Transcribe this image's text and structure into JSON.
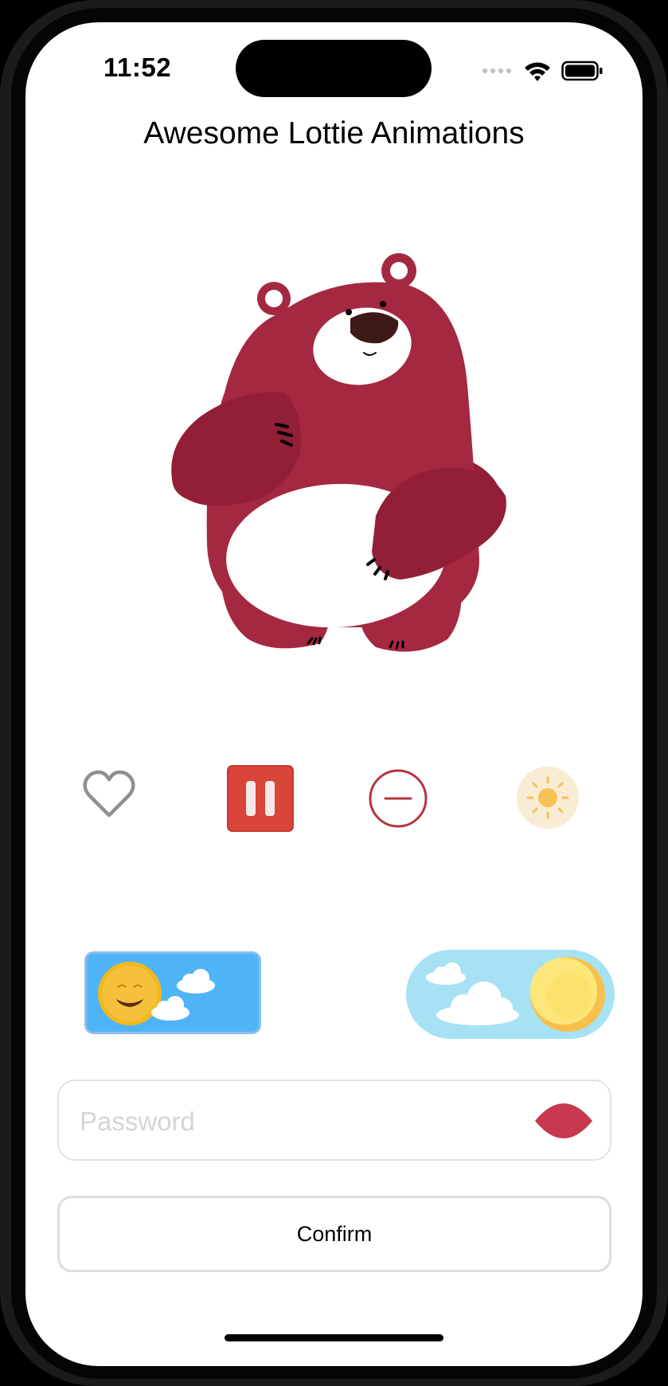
{
  "status_bar": {
    "time": "11:52",
    "icons": [
      "cellular-dots-icon",
      "wifi-icon",
      "battery-icon"
    ]
  },
  "header": {
    "title": "Awesome Lottie Animations"
  },
  "hero": {
    "animation": "bear-icon"
  },
  "controls": [
    {
      "name": "heart-icon",
      "color": "#8f8f8f"
    },
    {
      "name": "pause-icon",
      "color": "#d94538"
    },
    {
      "name": "minus-circle-icon",
      "color": "#b5333f"
    },
    {
      "name": "sun-icon",
      "color": "#f7c255"
    }
  ],
  "toggles": {
    "left": {
      "name": "day-sun-toggle",
      "color": "#4fb4f7"
    },
    "right": {
      "name": "day-night-toggle",
      "color": "#a6e2f4"
    }
  },
  "form": {
    "password": {
      "placeholder": "Password",
      "value": ""
    },
    "eye_icon": "eye-toggle-icon",
    "confirm_label": "Confirm"
  },
  "colors": {
    "bear": "#a52841",
    "bear_dark": "#931f36",
    "accent_red": "#d94538"
  }
}
